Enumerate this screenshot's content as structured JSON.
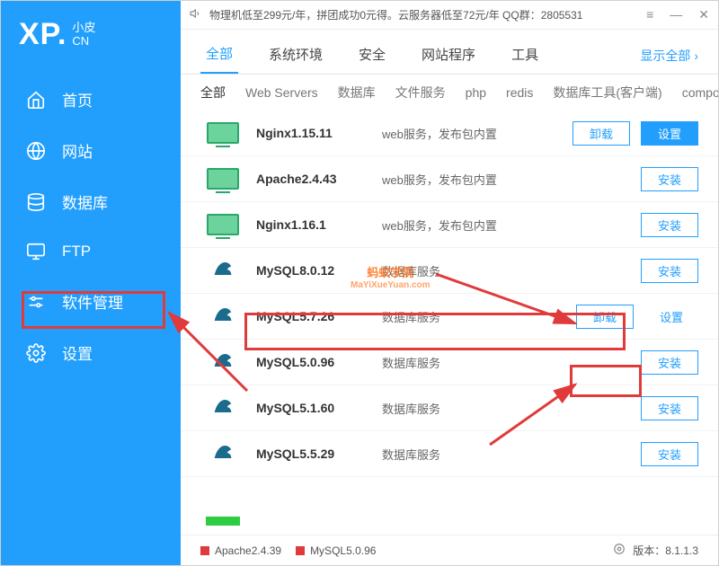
{
  "logo": {
    "xp": "XP.",
    "top": "小皮",
    "bottom": "CN"
  },
  "nav": [
    {
      "label": "首页",
      "icon": "home"
    },
    {
      "label": "网站",
      "icon": "globe"
    },
    {
      "label": "数据库",
      "icon": "db"
    },
    {
      "label": "FTP",
      "icon": "monitor"
    },
    {
      "label": "软件管理",
      "icon": "sliders"
    },
    {
      "label": "设置",
      "icon": "gear"
    }
  ],
  "announce": "物理机低至299元/年，拼团成功0元得。云服务器低至72元/年   QQ群：2805531",
  "tabs1": {
    "items": [
      "全部",
      "系统环境",
      "安全",
      "网站程序",
      "工具"
    ],
    "active": 0,
    "showall": "显示全部"
  },
  "tabs2": {
    "items": [
      "全部",
      "Web Servers",
      "数据库",
      "文件服务",
      "php",
      "redis",
      "数据库工具(客户端)",
      "composer"
    ],
    "active": 0
  },
  "rows": [
    {
      "icon": "web",
      "name": "Nginx1.15.11",
      "desc": "web服务，发布包内置",
      "actions": [
        {
          "label": "卸载",
          "type": "outline"
        },
        {
          "label": "设置",
          "type": "filled"
        }
      ]
    },
    {
      "icon": "web",
      "name": "Apache2.4.43",
      "desc": "web服务，发布包内置",
      "actions": [
        {
          "label": "安装",
          "type": "outline"
        }
      ]
    },
    {
      "icon": "web",
      "name": "Nginx1.16.1",
      "desc": "web服务，发布包内置",
      "actions": [
        {
          "label": "安装",
          "type": "outline"
        }
      ]
    },
    {
      "icon": "mysql",
      "name": "MySQL8.0.12",
      "desc": "数据库服务",
      "actions": [
        {
          "label": "安装",
          "type": "outline"
        }
      ]
    },
    {
      "icon": "mysql",
      "name": "MySQL5.7.26",
      "desc": "数据库服务",
      "actions": [
        {
          "label": "卸载",
          "type": "outline"
        },
        {
          "label": "设置",
          "type": "link"
        }
      ]
    },
    {
      "icon": "mysql",
      "name": "MySQL5.0.96",
      "desc": "数据库服务",
      "actions": [
        {
          "label": "安装",
          "type": "outline"
        }
      ]
    },
    {
      "icon": "mysql",
      "name": "MySQL5.1.60",
      "desc": "数据库服务",
      "actions": [
        {
          "label": "安装",
          "type": "outline"
        }
      ]
    },
    {
      "icon": "mysql",
      "name": "MySQL5.5.29",
      "desc": "数据库服务",
      "actions": [
        {
          "label": "安装",
          "type": "outline"
        }
      ]
    }
  ],
  "footer": {
    "s1": "Apache2.4.39",
    "s2": "MySQL5.0.96",
    "version_label": "版本：",
    "version": "8.1.1.3"
  },
  "watermark": {
    "line1": "蚂蚁学院",
    "line2": "MaYiXueYuan.com"
  }
}
